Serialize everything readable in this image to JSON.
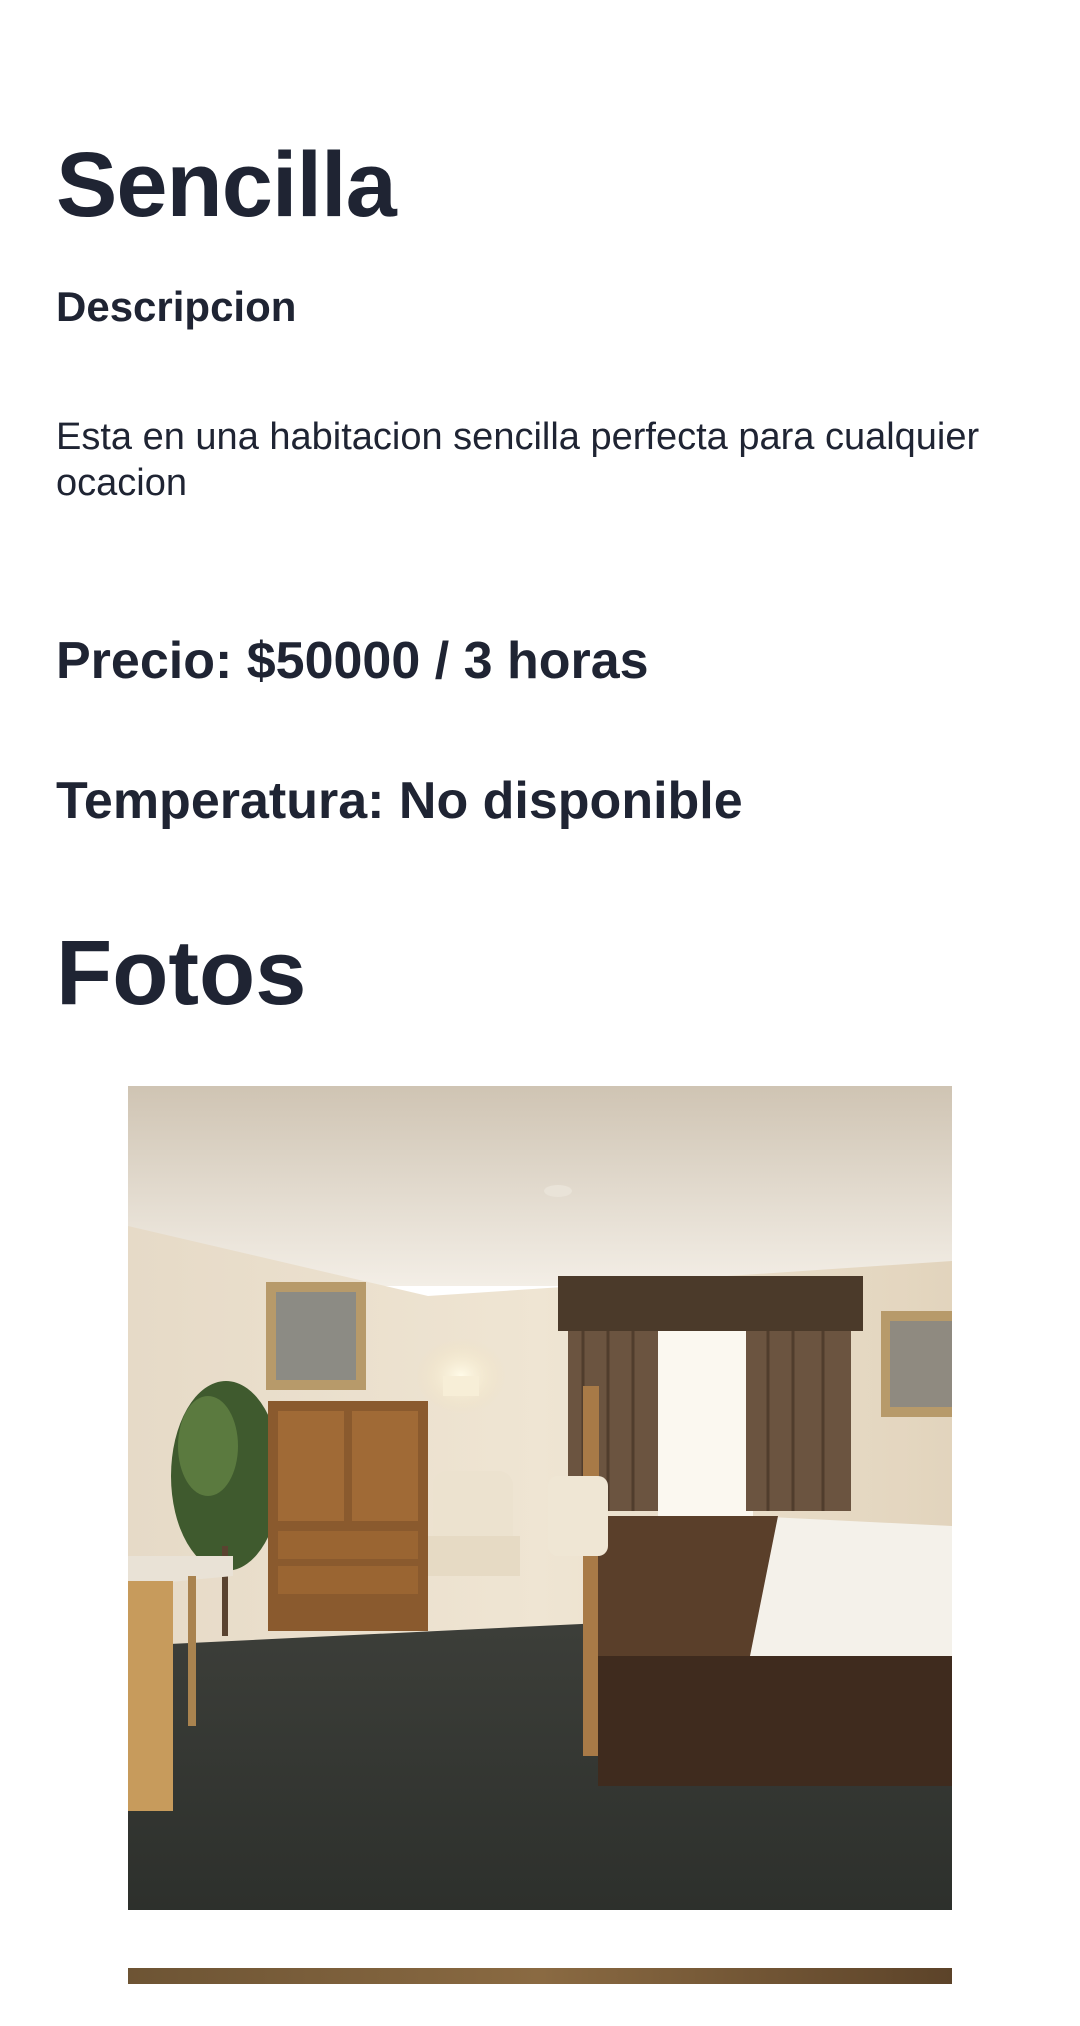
{
  "room": {
    "title": "Sencilla",
    "description_heading": "Descripcion",
    "description_text": "Esta en una habitacion sencilla perfecta para cualquier ocacion",
    "price_label": "Precio: $50000 / 3 horas",
    "temperature_label": "Temperatura: No disponible"
  },
  "photos": {
    "heading": "Fotos",
    "items": [
      {
        "subject": "hotel room with bed, armoire, armchair, window and plant"
      },
      {
        "subject": "second room photo (partially visible)"
      }
    ]
  },
  "colors": {
    "text": "#1f2433",
    "background": "#ffffff"
  }
}
